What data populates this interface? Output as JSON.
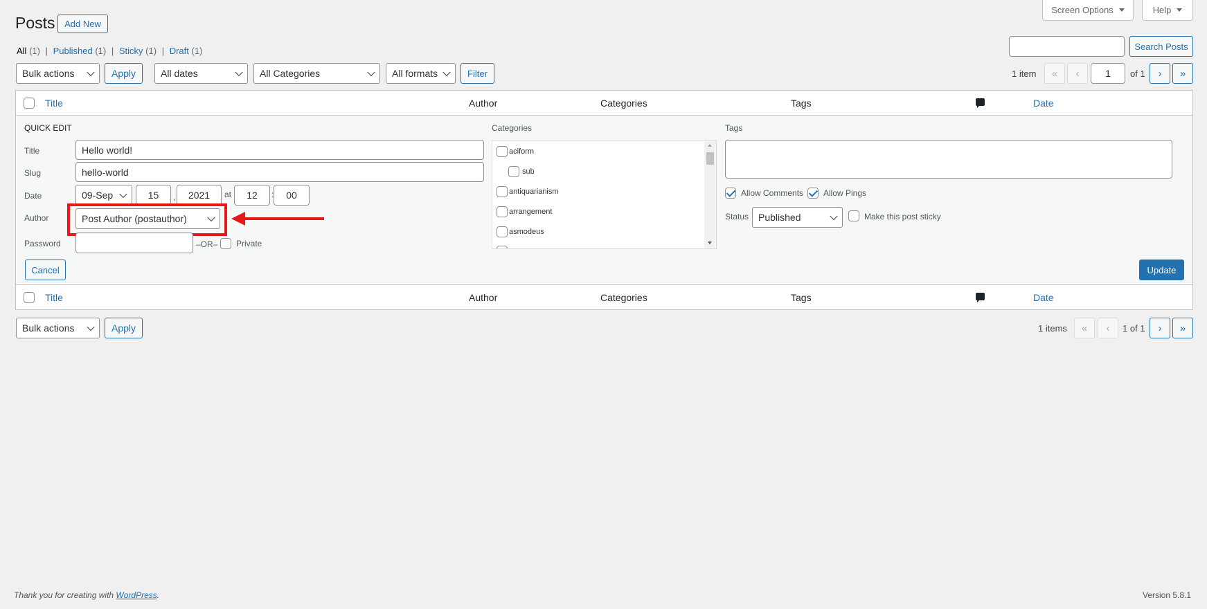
{
  "header": {
    "page_title": "Posts",
    "add_new": "Add New",
    "screen_options": "Screen Options",
    "help": "Help"
  },
  "filters_links": [
    {
      "label": "All",
      "count": "(1)"
    },
    {
      "label": "Published",
      "count": "(1)"
    },
    {
      "label": "Sticky",
      "count": "(1)"
    },
    {
      "label": "Draft",
      "count": "(1)"
    }
  ],
  "search": {
    "value": "",
    "button": "Search Posts"
  },
  "toolbar": {
    "bulk_actions": "Bulk actions",
    "apply": "Apply",
    "dates": "All dates",
    "categories": "All Categories",
    "formats": "All formats",
    "filter": "Filter"
  },
  "pagination_top": {
    "items": "1 item",
    "page": "1",
    "of": "of 1"
  },
  "pagination_bottom": {
    "items": "1 items",
    "of": "1 of 1"
  },
  "table": {
    "columns": {
      "title": "Title",
      "author": "Author",
      "categories": "Categories",
      "tags": "Tags",
      "date": "Date"
    }
  },
  "quick_edit": {
    "heading": "QUICK EDIT",
    "title_label": "Title",
    "title_value": "Hello world!",
    "slug_label": "Slug",
    "slug_value": "hello-world",
    "date_label": "Date",
    "month": "09-Sep",
    "day": "15",
    "year": "2021",
    "at": "at",
    "hour": "12",
    "colon": ":",
    "minute": "00",
    "comma": ",",
    "author_label": "Author",
    "author_value": "Post Author (postauthor)",
    "password_label": "Password",
    "password_value": "",
    "or": "–OR–",
    "private": "Private",
    "cancel": "Cancel",
    "update": "Update",
    "categories_label": "Categories",
    "categories": [
      {
        "label": "aciform",
        "checked": false,
        "child": false
      },
      {
        "label": "sub",
        "checked": false,
        "child": true
      },
      {
        "label": "antiquarianism",
        "checked": false,
        "child": false
      },
      {
        "label": "arrangement",
        "checked": false,
        "child": false
      },
      {
        "label": "asmodeus",
        "checked": false,
        "child": false
      }
    ],
    "tags_label": "Tags",
    "tags_value": "",
    "allow_comments": "Allow Comments",
    "allow_pings": "Allow Pings",
    "status_label": "Status",
    "status_value": "Published",
    "sticky": "Make this post sticky"
  },
  "footer": {
    "thanks_prefix": "Thank you for creating with ",
    "wordpress": "WordPress",
    "period": ".",
    "version": "Version 5.8.1"
  },
  "annotation": {
    "highlight_color": "#e81818"
  }
}
